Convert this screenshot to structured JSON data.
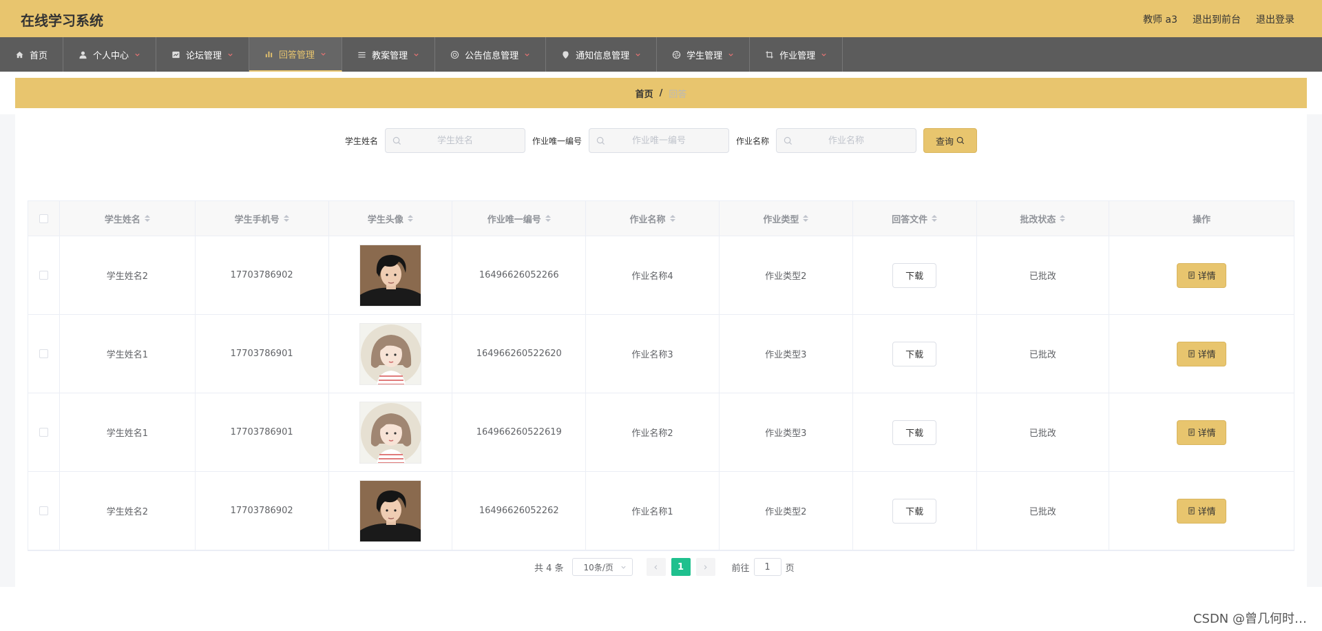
{
  "header": {
    "title": "在线学习系统",
    "user": "教师 a3",
    "to_front": "退出到前台",
    "logout": "退出登录"
  },
  "nav": [
    {
      "label": "首页",
      "icon": "home-icon",
      "dropdown": false,
      "active": false
    },
    {
      "label": "个人中心",
      "icon": "user-icon",
      "dropdown": true,
      "active": false
    },
    {
      "label": "论坛管理",
      "icon": "forum-icon",
      "dropdown": true,
      "active": false
    },
    {
      "label": "回答管理",
      "icon": "bar-chart-icon",
      "dropdown": true,
      "active": true
    },
    {
      "label": "教案管理",
      "icon": "list-icon",
      "dropdown": true,
      "active": false
    },
    {
      "label": "公告信息管理",
      "icon": "target-icon",
      "dropdown": true,
      "active": false
    },
    {
      "label": "通知信息管理",
      "icon": "location-icon",
      "dropdown": true,
      "active": false
    },
    {
      "label": "学生管理",
      "icon": "aperture-icon",
      "dropdown": true,
      "active": false
    },
    {
      "label": "作业管理",
      "icon": "crop-icon",
      "dropdown": true,
      "active": false
    }
  ],
  "breadcrumb": {
    "home": "首页",
    "separator": "/",
    "current": "回答"
  },
  "search": {
    "student_name_label": "学生姓名",
    "student_name_placeholder": "学生姓名",
    "homework_id_label": "作业唯一编号",
    "homework_id_placeholder": "作业唯一编号",
    "homework_name_label": "作业名称",
    "homework_name_placeholder": "作业名称",
    "query_label": "查询"
  },
  "table": {
    "headers": [
      "学生姓名",
      "学生手机号",
      "学生头像",
      "作业唯一编号",
      "作业名称",
      "作业类型",
      "回答文件",
      "批改状态",
      "操作"
    ],
    "rows": [
      {
        "name": "学生姓名2",
        "phone": "17703786902",
        "avatar": "male",
        "hw_id": "16496626052266",
        "hw_name": "作业名称4",
        "hw_type": "作业类型2",
        "download": "下载",
        "status": "已批改",
        "detail": "详情"
      },
      {
        "name": "学生姓名1",
        "phone": "17703786901",
        "avatar": "female",
        "hw_id": "164966260522620",
        "hw_name": "作业名称3",
        "hw_type": "作业类型3",
        "download": "下载",
        "status": "已批改",
        "detail": "详情"
      },
      {
        "name": "学生姓名1",
        "phone": "17703786901",
        "avatar": "female",
        "hw_id": "164966260522619",
        "hw_name": "作业名称2",
        "hw_type": "作业类型3",
        "download": "下载",
        "status": "已批改",
        "detail": "详情"
      },
      {
        "name": "学生姓名2",
        "phone": "17703786902",
        "avatar": "male",
        "hw_id": "16496626052262",
        "hw_name": "作业名称1",
        "hw_type": "作业类型2",
        "download": "下载",
        "status": "已批改",
        "detail": "详情"
      }
    ]
  },
  "pagination": {
    "total": "共 4 条",
    "page_size": "10条/页",
    "current_page": "1",
    "goto_label": "前往",
    "goto_value": "1",
    "goto_suffix": "页"
  },
  "watermark": "CSDN @曾几何时…",
  "colors": {
    "accent": "#e8c56e",
    "nav_bg": "#5c5c5c",
    "page_active": "#1fc08e"
  }
}
